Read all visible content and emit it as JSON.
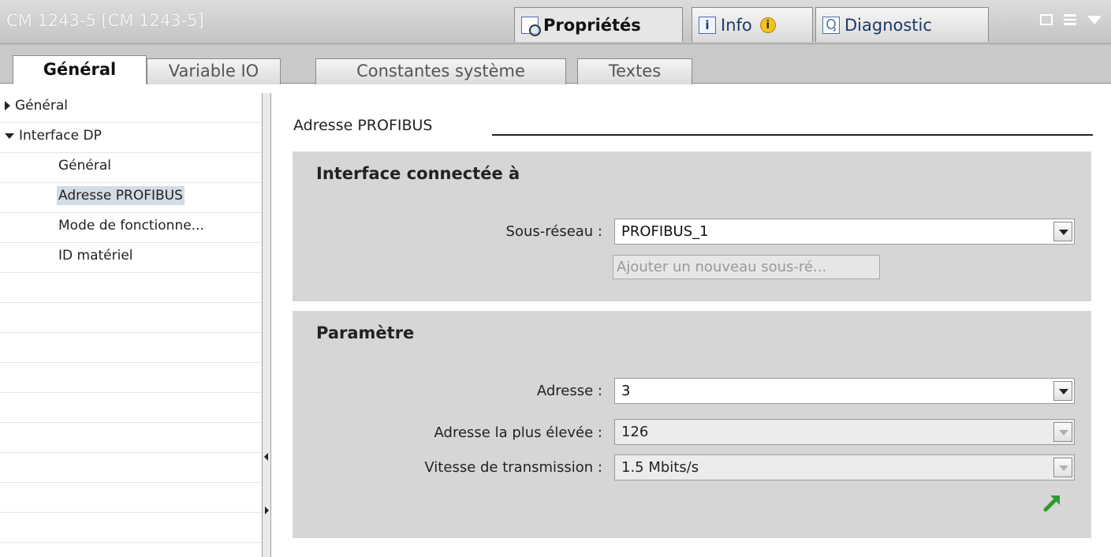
{
  "window": {
    "title": "CM 1243-5 [CM 1243-5]",
    "tabs": [
      {
        "label": "Propriétés",
        "icon": "properties-icon",
        "active": true
      },
      {
        "label": "Info",
        "icon": "info-icon",
        "badge": "i",
        "active": false
      },
      {
        "label": "Diagnostic",
        "icon": "diagnostic-icon",
        "active": false
      }
    ]
  },
  "section_tabs": [
    {
      "label": "Général",
      "active": true
    },
    {
      "label": "Variable IO",
      "active": false
    },
    {
      "label": "Constantes système",
      "active": false
    },
    {
      "label": "Textes",
      "active": false
    }
  ],
  "nav": {
    "items": [
      {
        "label": "Général",
        "expander": "collapsed"
      },
      {
        "label": "Interface DP",
        "expander": "expanded"
      },
      {
        "label": "Général"
      },
      {
        "label": "Adresse PROFIBUS",
        "selected": true
      },
      {
        "label": "Mode de fonctionne..."
      },
      {
        "label": "ID matériel"
      }
    ]
  },
  "content": {
    "section_title": "Adresse PROFIBUS",
    "interface_box": {
      "title": "Interface connectée à",
      "subnet_label": "Sous-réseau :",
      "subnet_value": "PROFIBUS_1",
      "add_subnet_button": "Ajouter un nouveau sous-ré..."
    },
    "param_box": {
      "title": "Paramètre",
      "address_label": "Adresse :",
      "address_value": "3",
      "highest_label": "Adresse la plus élevée :",
      "highest_value": "126",
      "speed_label": "Vitesse de transmission :",
      "speed_value": "1.5 Mbits/s"
    }
  },
  "colors": {
    "accent_green": "#2e9b2e",
    "selection": "#d3dbe4",
    "panel_gray": "#d6d6d6"
  }
}
